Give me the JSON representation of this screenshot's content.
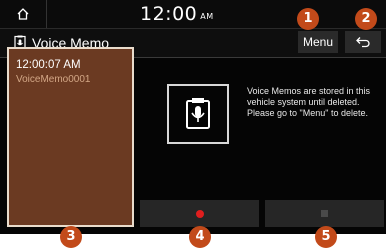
{
  "status_bar": {
    "time": "12:00",
    "am_pm": "AM"
  },
  "header": {
    "title": "Voice Memo",
    "menu_label": "Menu"
  },
  "memo_list": {
    "items": [
      {
        "time": "12:00:07 AM",
        "name": "VoiceMemo0001"
      }
    ]
  },
  "info": {
    "message": "Voice Memos are stored in this vehicle system until deleted. Please go to \"Menu\" to delete."
  },
  "callouts": [
    "1",
    "2",
    "3",
    "4",
    "5"
  ],
  "colors": {
    "accent": "#c24a1a",
    "list_bg": "#6b3a22",
    "record": "#e01e1e"
  },
  "icons": [
    "home-icon",
    "voice-memo-icon",
    "back-icon",
    "microphone-icon",
    "record-icon",
    "stop-icon"
  ]
}
